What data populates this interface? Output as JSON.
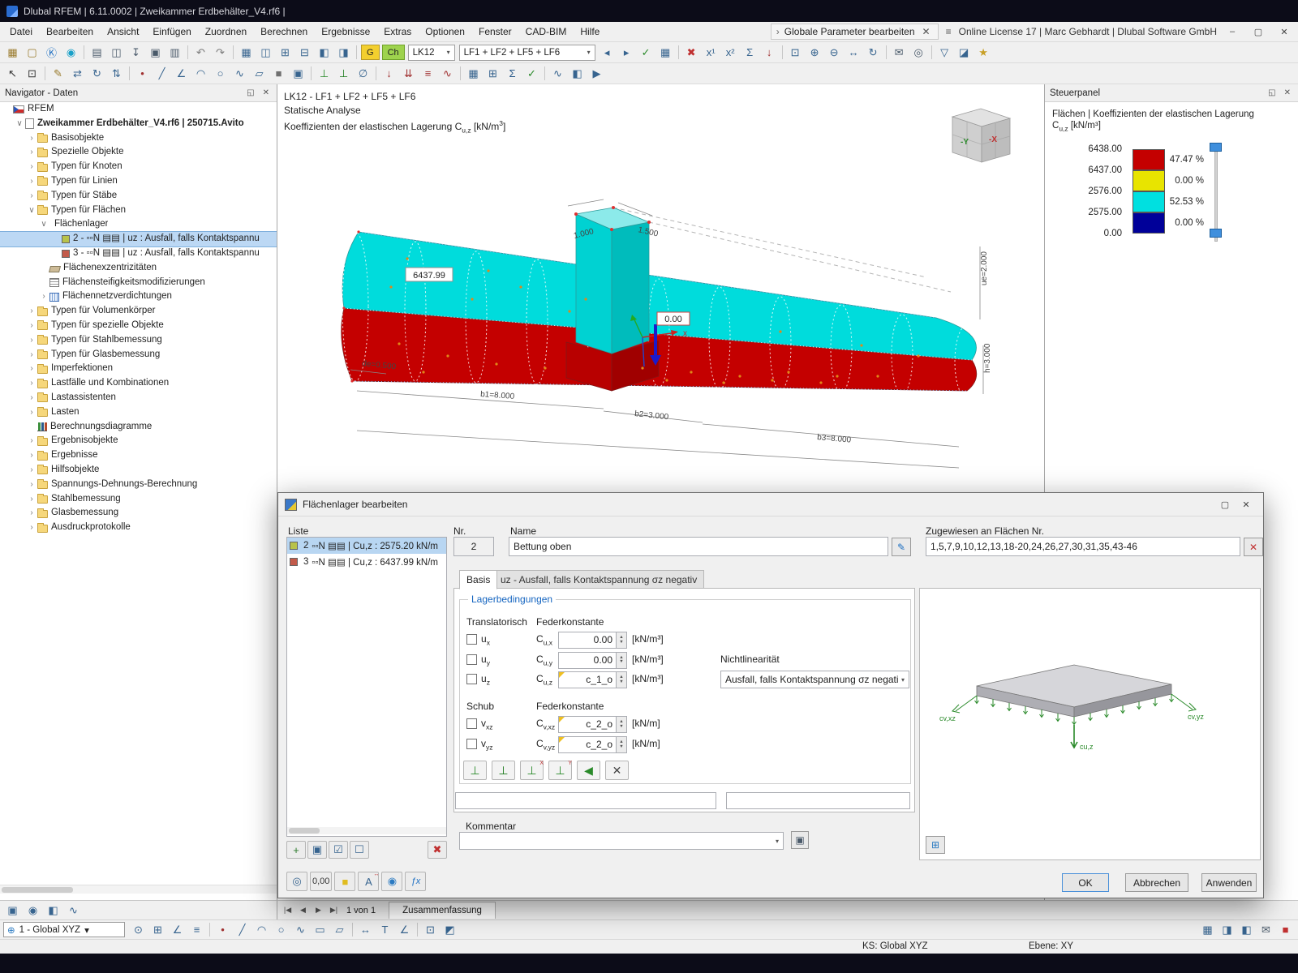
{
  "glyphs": {
    "dropdown": "▾",
    "close_x": "✕",
    "chevron_right": "›",
    "dock_pin": "◱",
    "window_min": "–",
    "window_max": "▢",
    "window_close": "✕",
    "menu_search": "≡",
    "spin_up": "▲",
    "spin_down": "▼",
    "combo_prev": "◂",
    "combo_next": "▸",
    "nav_first": "|◀",
    "nav_prev": "◀",
    "nav_next": "▶",
    "nav_last": "▶|",
    "edit_pencil": "✎",
    "clear_assign": "✕",
    "copy_comment": "▣",
    "preview_values": "⊞",
    "axes_combo": "⊕",
    "dlg_max": "▢",
    "dlg_close": "✕"
  },
  "titlebar": {
    "title": "Dlubal RFEM | 6.11.0002 | Zweikammer Erdbehälter_V4.rf6 |"
  },
  "menubar": {
    "items": [
      "Datei",
      "Bearbeiten",
      "Ansicht",
      "Einfügen",
      "Zuordnen",
      "Berechnen",
      "Ergebnisse",
      "Extras",
      "Optionen",
      "Fenster",
      "CAD-BIM",
      "Hilfe"
    ],
    "global_param_label": "Globale Parameter bearbeiten",
    "license_text": "Online License 17 | Marc Gebhardt | Dlubal Software GmbH"
  },
  "toolbar_top": {
    "g_label": "G",
    "ch_label": "Ch",
    "lk_combo": "LK12",
    "lf_combo": "LF1 + LF2 + LF5 + LF6",
    "icons_a": [
      {
        "n": "new-model-icon",
        "g": "▦",
        "c": "#9a7b2d"
      },
      {
        "n": "open-model-icon",
        "g": "▢",
        "c": "#9a7b2d"
      },
      {
        "n": "rfem-app-icon",
        "g": "Ⓚ",
        "c": "#1b6ec2"
      },
      {
        "n": "dlubal-online-icon",
        "g": "◉",
        "c": "#18a0c8"
      },
      {
        "sep": true
      },
      {
        "n": "print-icon",
        "g": "▤",
        "c": "#4a5a6a"
      },
      {
        "n": "save-icon",
        "g": "◫",
        "c": "#4a5a6a"
      },
      {
        "n": "export-icon",
        "g": "↧",
        "c": "#4a5a6a"
      },
      {
        "n": "copy-graphic-icon",
        "g": "▣",
        "c": "#4a5a6a"
      },
      {
        "n": "printout-report-icon",
        "g": "▥",
        "c": "#4a5a6a"
      },
      {
        "sep": true
      },
      {
        "n": "undo-icon",
        "g": "↶",
        "c": "#7a7a7a"
      },
      {
        "n": "redo-icon",
        "g": "↷",
        "c": "#7a7a7a"
      },
      {
        "sep": true
      },
      {
        "n": "table-view-icon",
        "g": "▦",
        "c": "#37648f"
      },
      {
        "n": "table-layout-icon",
        "g": "◫",
        "c": "#37648f"
      },
      {
        "n": "workplane-icon",
        "g": "⊞",
        "c": "#37648f"
      },
      {
        "n": "section-view-icon",
        "g": "⊟",
        "c": "#37648f"
      },
      {
        "n": "display-properties-icon",
        "g": "◧",
        "c": "#37648f"
      },
      {
        "n": "visibility-icon",
        "g": "◨",
        "c": "#37648f"
      },
      {
        "sep": true
      }
    ],
    "icons_b": [
      {
        "n": "show-results-icon",
        "g": "✓",
        "c": "#2a8a2a"
      },
      {
        "n": "results-table-icon",
        "g": "▦",
        "c": "#37648f"
      },
      {
        "sep": true
      },
      {
        "n": "delete-results-icon",
        "g": "✖",
        "c": "#c03030"
      },
      {
        "n": "calculate-x1-icon",
        "g": "x¹",
        "c": "#37648f"
      },
      {
        "n": "calculate-x2-icon",
        "g": "x²",
        "c": "#37648f"
      },
      {
        "n": "calculate-all-icon",
        "g": "Σ",
        "c": "#37648f"
      },
      {
        "n": "loads-display-icon",
        "g": "↓",
        "c": "#a03030"
      },
      {
        "sep": true
      },
      {
        "n": "zoom-window-icon",
        "g": "⊡",
        "c": "#37648f"
      },
      {
        "n": "zoom-in-icon",
        "g": "⊕",
        "c": "#37648f"
      },
      {
        "n": "zoom-out-icon",
        "g": "⊖",
        "c": "#37648f"
      },
      {
        "n": "move-view-icon",
        "g": "↔",
        "c": "#37648f"
      },
      {
        "n": "rotate-view-icon",
        "g": "↻",
        "c": "#37648f"
      },
      {
        "sep": true
      },
      {
        "n": "send-mail-icon",
        "g": "✉",
        "c": "#4a5a6a"
      },
      {
        "n": "snapshot-icon",
        "g": "◎",
        "c": "#4a5a6a"
      },
      {
        "sep": true
      },
      {
        "n": "filter-objects-icon",
        "g": "▽",
        "c": "#37648f"
      },
      {
        "n": "clipping-icon",
        "g": "◪",
        "c": "#37648f"
      },
      {
        "n": "favorites-icon",
        "g": "★",
        "c": "#c8a028"
      }
    ]
  },
  "toolbar_second": {
    "icons": [
      {
        "n": "select-pointer-icon",
        "g": "↖",
        "c": "#333333"
      },
      {
        "n": "select-box-icon",
        "g": "⊡",
        "c": "#333333"
      },
      {
        "sep": true
      },
      {
        "n": "edit-icon",
        "g": "✎",
        "c": "#9a7b2d"
      },
      {
        "n": "move-copy-icon",
        "g": "⇄",
        "c": "#37648f"
      },
      {
        "n": "rotate-icon",
        "g": "↻",
        "c": "#37648f"
      },
      {
        "n": "mirror-icon",
        "g": "⇅",
        "c": "#37648f"
      },
      {
        "sep": true
      },
      {
        "n": "node-icon",
        "g": "•",
        "c": "#a03030"
      },
      {
        "n": "line-icon",
        "g": "╱",
        "c": "#37648f"
      },
      {
        "n": "polyline-icon",
        "g": "∠",
        "c": "#37648f"
      },
      {
        "n": "arc-icon",
        "g": "◠",
        "c": "#37648f"
      },
      {
        "n": "circle-icon",
        "g": "○",
        "c": "#37648f"
      },
      {
        "n": "spline-icon",
        "g": "∿",
        "c": "#37648f"
      },
      {
        "n": "surface-icon",
        "g": "▱",
        "c": "#37648f"
      },
      {
        "n": "solid-icon",
        "g": "■",
        "c": "#707070"
      },
      {
        "n": "opening-icon",
        "g": "▣",
        "c": "#37648f"
      },
      {
        "sep": true
      },
      {
        "n": "nodal-support-icon",
        "g": "⊥",
        "c": "#2a8a2a"
      },
      {
        "n": "line-support-icon",
        "g": "⊥",
        "c": "#1a7a1a"
      },
      {
        "n": "hinge-icon",
        "g": "∅",
        "c": "#37648f"
      },
      {
        "sep": true
      },
      {
        "n": "nodal-load-icon",
        "g": "↓",
        "c": "#a03030"
      },
      {
        "n": "line-load-icon",
        "g": "⇊",
        "c": "#a03030"
      },
      {
        "n": "surface-load-icon",
        "g": "≡",
        "c": "#a03030"
      },
      {
        "n": "free-load-icon",
        "g": "∿",
        "c": "#a03030"
      },
      {
        "sep": true
      },
      {
        "n": "mesh-icon",
        "g": "▦",
        "c": "#37648f"
      },
      {
        "n": "mesh-settings-icon",
        "g": "⊞",
        "c": "#37648f"
      },
      {
        "n": "calculate-icon",
        "g": "Σ",
        "c": "#2a5a8a"
      },
      {
        "n": "check-model-icon",
        "g": "✓",
        "c": "#2a8a2a"
      },
      {
        "sep": true
      },
      {
        "n": "result-diagram-icon",
        "g": "∿",
        "c": "#37648f"
      },
      {
        "n": "panel-colors-icon",
        "g": "◧",
        "c": "#37648f"
      },
      {
        "n": "animation-icon",
        "g": "▶",
        "c": "#37648f"
      }
    ]
  },
  "navigator": {
    "title": "Navigator - Daten",
    "footer_icons": [
      {
        "n": "navigator-data-icon",
        "g": "▣",
        "c": "#37648f"
      },
      {
        "n": "navigator-display-icon",
        "g": "◉",
        "c": "#37648f"
      },
      {
        "n": "navigator-views-icon",
        "g": "◧",
        "c": "#37648f"
      },
      {
        "n": "navigator-results-icon",
        "g": "∿",
        "c": "#37648f"
      }
    ],
    "tree": [
      {
        "label": "RFEM",
        "level": 0,
        "icon": "flag"
      },
      {
        "label": "Zweikammer Erdbehälter_V4.rf6 | 250715.Avito",
        "level": 1,
        "icon": "doc",
        "bold": true,
        "exp": "open"
      },
      {
        "label": "Basisobjekte",
        "level": 2,
        "icon": "folder",
        "exp": "closed"
      },
      {
        "label": "Spezielle Objekte",
        "level": 2,
        "icon": "folder",
        "exp": "closed"
      },
      {
        "label": "Typen für Knoten",
        "level": 2,
        "icon": "folder",
        "exp": "closed"
      },
      {
        "label": "Typen für Linien",
        "level": 2,
        "icon": "folder",
        "exp": "closed"
      },
      {
        "label": "Typen für Stäbe",
        "level": 2,
        "icon": "folder",
        "exp": "closed"
      },
      {
        "label": "Typen für Flächen",
        "level": 2,
        "icon": "folder",
        "exp": "open"
      },
      {
        "label": "Flächenlager",
        "level": 3,
        "icon": "none",
        "exp": "open"
      },
      {
        "label": "2 - ▫▫N ▤▤ | uz : Ausfall, falls Kontaktspannu",
        "level": 4,
        "icon": "swatch",
        "color": "#b8c24a",
        "selected": true
      },
      {
        "label": "3 - ▫▫N ▤▤ | uz : Ausfall, falls Kontaktspannu",
        "level": 4,
        "icon": "swatch",
        "color": "#c25a4a"
      },
      {
        "label": "Flächenexzentrizitäten",
        "level": 3,
        "icon": "ecc"
      },
      {
        "label": "Flächensteifigkeitsmodifizierungen",
        "level": 3,
        "icon": "grid"
      },
      {
        "label": "Flächennetzverdichtungen",
        "level": 3,
        "icon": "mesh",
        "exp": "closed"
      },
      {
        "label": "Typen für Volumenkörper",
        "level": 2,
        "icon": "folder",
        "exp": "closed"
      },
      {
        "label": "Typen für spezielle Objekte",
        "level": 2,
        "icon": "folder",
        "exp": "closed"
      },
      {
        "label": "Typen für Stahlbemessung",
        "level": 2,
        "icon": "folder",
        "exp": "closed"
      },
      {
        "label": "Typen für Glasbemessung",
        "level": 2,
        "icon": "folder",
        "exp": "closed"
      },
      {
        "label": "Imperfektionen",
        "level": 2,
        "icon": "folder",
        "exp": "closed"
      },
      {
        "label": "Lastfälle und Kombinationen",
        "level": 2,
        "icon": "folder",
        "exp": "closed"
      },
      {
        "label": "Lastassistenten",
        "level": 2,
        "icon": "folder",
        "exp": "closed"
      },
      {
        "label": "Lasten",
        "level": 2,
        "icon": "folder",
        "exp": "closed"
      },
      {
        "label": "Berechnungsdiagramme",
        "level": 2,
        "icon": "chart"
      },
      {
        "label": "Ergebnisobjekte",
        "level": 2,
        "icon": "folder",
        "exp": "closed"
      },
      {
        "label": "Ergebnisse",
        "level": 2,
        "icon": "folder",
        "exp": "closed"
      },
      {
        "label": "Hilfsobjekte",
        "level": 2,
        "icon": "folder",
        "exp": "closed"
      },
      {
        "label": "Spannungs-Dehnungs-Berechnung",
        "level": 2,
        "icon": "folder",
        "exp": "closed"
      },
      {
        "label": "Stahlbemessung",
        "level": 2,
        "icon": "folder",
        "exp": "closed"
      },
      {
        "label": "Glasbemessung",
        "level": 2,
        "icon": "folder",
        "exp": "closed"
      },
      {
        "label": "Ausdruckprotokolle",
        "level": 2,
        "icon": "folder",
        "exp": "closed"
      }
    ]
  },
  "viewport": {
    "line1": "LK12 - LF1 + LF2 + LF5 + LF6",
    "line2": "Statische Analyse",
    "line3_prefix": "Koeffizienten der elastischen Lagerung C",
    "line3_sub": "u,z",
    "line3_mid": " [kN/m",
    "line3_sup": "3",
    "line3_close": "]",
    "labels": {
      "value_max": "6437.99",
      "value_zero": "0.00",
      "dim_de": "de=0.500",
      "dim_b1": "b1=8.000",
      "dim_b2": "b2=3.000",
      "dim_b3": "b3=8.000",
      "dim_1000": "1.000",
      "dim_1500": "1.500",
      "dim_h": "h=3.000",
      "dim_ue": "ue=2.000",
      "axis_x": "x"
    },
    "cube": {
      "front": "-Y",
      "side": "-X"
    }
  },
  "steuerpanel": {
    "title": "Steuerpanel",
    "subtitle1": "Flächen | Koeffizienten der elastischen Lagerung",
    "subtitle2_sym": "C",
    "subtitle2_sub": "u,z",
    "subtitle2_rest": " [kN/m³]",
    "scale_values": [
      "6438.00",
      "6437.00",
      "2576.00",
      "2575.00",
      "0.00"
    ],
    "scale_rows": [
      {
        "color": "#c40000",
        "pct": "47.47 %"
      },
      {
        "color": "#e8e400",
        "pct": "0.00 %"
      },
      {
        "color": "#00e0e0",
        "pct": "52.53 %"
      },
      {
        "color": "#000099",
        "pct": "0.00 %"
      }
    ]
  },
  "dialog": {
    "title": "Flächenlager bearbeiten",
    "liste_label": "Liste",
    "list_items": [
      {
        "nr": "2",
        "swatch": "#b8c24a",
        "text": "▫▫N ▤▤ | Cu,z : 2575.20 kN/m",
        "selected": true
      },
      {
        "nr": "3",
        "swatch": "#c25a4a",
        "text": "▫▫N ▤▤ | Cu,z : 6437.99 kN/m",
        "selected": false
      }
    ],
    "list_tools": [
      {
        "n": "new-list-item-button",
        "g": "+",
        "c": "#2a7a2a"
      },
      {
        "n": "copy-list-item-button",
        "g": "▣",
        "c": "#37648f"
      },
      {
        "n": "check-all-button",
        "g": "☑",
        "c": "#37648f"
      },
      {
        "n": "uncheck-all-button",
        "g": "☐",
        "c": "#37648f"
      },
      {
        "spacer": true
      },
      {
        "n": "delete-list-item-button",
        "g": "✖",
        "c": "#c03030"
      }
    ],
    "nr_label": "Nr.",
    "nr_value": "2",
    "name_label": "Name",
    "name_value": "Bettung oben",
    "assigned_label": "Zugewiesen an Flächen Nr.",
    "assigned_value": "1,5,7,9,10,12,13,18-20,24,26,27,30,31,35,43-46",
    "tabs": [
      "Basis",
      "uz - Ausfall, falls Kontaktspannung σz negativ"
    ],
    "group_title": "Lagerbedingungen",
    "col_translatorisch": "Translatorisch",
    "col_feder": "Federkonstante",
    "col_schub": "Schub",
    "col_feder2": "Federkonstante",
    "col_nichtlin": "Nichtlinearität",
    "rows_trans": [
      {
        "chk": "ux",
        "sym": "u",
        "sub": "x",
        "csub": "u,x",
        "value": "0.00",
        "unit": "[kN/m³]"
      },
      {
        "chk": "uy",
        "sym": "u",
        "sub": "y",
        "csub": "u,y",
        "value": "0.00",
        "unit": "[kN/m³]"
      },
      {
        "chk": "uz",
        "sym": "u",
        "sub": "z",
        "csub": "u,z",
        "value": "c_1_o",
        "unit": "[kN/m³]",
        "param": true
      }
    ],
    "rows_schub": [
      {
        "chk": "vxz",
        "sym": "v",
        "sub": "xz",
        "csub": "v,xz",
        "value": "c_2_o",
        "unit": "[kN/m]",
        "param": true
      },
      {
        "chk": "vyz",
        "sym": "v",
        "sub": "yz",
        "csub": "v,yz",
        "value": "c_2_o",
        "unit": "[kN/m]",
        "param": true
      }
    ],
    "nichtlin_value": "Ausfall, falls Kontaktspannung σz negativ",
    "support_buttons": [
      {
        "n": "support-hinged-button",
        "g": "⊥",
        "c": "#2a8a2a"
      },
      {
        "n": "support-rigid-button",
        "g": "⊥",
        "c": "#1a7a1a"
      },
      {
        "n": "support-x-button",
        "g": "⊥",
        "c": "#2a8a2a",
        "tag": "X"
      },
      {
        "n": "support-y-button",
        "g": "⊥",
        "c": "#2a8a2a",
        "tag": "Y"
      },
      {
        "n": "support-sliding-button",
        "g": "◀",
        "c": "#2a8a2a"
      },
      {
        "n": "support-none-button",
        "g": "✕",
        "c": "#444444"
      }
    ],
    "kommentar_label": "Kommentar",
    "preview_labels": {
      "left": "cv,xz",
      "center": "cu,z",
      "right": "cv,yz"
    },
    "tools": [
      {
        "n": "special-selection-button",
        "g": "◎",
        "c": "#37648f"
      },
      {
        "n": "decimal-places-button",
        "t": "0,00",
        "c": "#333333"
      },
      {
        "n": "color-scale-button",
        "g": "■",
        "c": "#e0bc20"
      },
      {
        "n": "units-settings-button",
        "g": "A",
        "c": "#37648f",
        "tag": "↔"
      },
      {
        "n": "display-settings-button",
        "g": "◉",
        "c": "#2a7ac2"
      },
      {
        "n": "formula-button",
        "t": "ƒx",
        "c": "#1b6ec2",
        "it": true
      }
    ],
    "ok": "OK",
    "cancel": "Abbrechen",
    "apply": "Anwenden"
  },
  "bottombar": {
    "page_indicator": "1 von 1",
    "tab": "Zusammenfassung",
    "coord_combo": "1 - Global XYZ",
    "ks_label": "KS: Global XYZ",
    "ebene_label": "Ebene: XY",
    "icons": [
      {
        "n": "snap-icon",
        "g": "⊙",
        "c": "#37648f"
      },
      {
        "n": "grid-icon",
        "g": "⊞",
        "c": "#37648f"
      },
      {
        "n": "ortho-icon",
        "g": "∠",
        "c": "#37648f"
      },
      {
        "n": "guidelines-icon",
        "g": "≡",
        "c": "#37648f"
      },
      {
        "sep": true
      },
      {
        "n": "draw-node-icon",
        "g": "•",
        "c": "#a03030"
      },
      {
        "n": "draw-line-icon",
        "g": "╱",
        "c": "#37648f"
      },
      {
        "n": "draw-arc-icon",
        "g": "◠",
        "c": "#37648f"
      },
      {
        "n": "draw-circle-icon",
        "g": "○",
        "c": "#37648f"
      },
      {
        "n": "draw-spline-icon",
        "g": "∿",
        "c": "#37648f"
      },
      {
        "n": "draw-rect-icon",
        "g": "▭",
        "c": "#37648f"
      },
      {
        "n": "draw-polygon-icon",
        "g": "▱",
        "c": "#37648f"
      },
      {
        "sep": true
      },
      {
        "n": "dimension-icon",
        "g": "↔",
        "c": "#37648f"
      },
      {
        "n": "text-comment-icon",
        "g": "T",
        "c": "#37648f"
      },
      {
        "n": "measure-icon",
        "g": "∠",
        "c": "#37648f"
      },
      {
        "sep": true
      },
      {
        "n": "select-all-icon",
        "g": "⊡",
        "c": "#37648f"
      },
      {
        "n": "invert-selection-icon",
        "g": "◩",
        "c": "#37648f"
      }
    ],
    "right_icons": [
      {
        "n": "tables-toggle-icon",
        "g": "▦",
        "c": "#37648f"
      },
      {
        "n": "panel-toggle-icon",
        "g": "◨",
        "c": "#37648f"
      },
      {
        "n": "navigator-toggle-icon",
        "g": "◧",
        "c": "#37648f"
      },
      {
        "n": "messages-icon",
        "g": "✉",
        "c": "#4a5a6a"
      },
      {
        "n": "record-icon",
        "g": "■",
        "c": "#c03030"
      }
    ]
  }
}
